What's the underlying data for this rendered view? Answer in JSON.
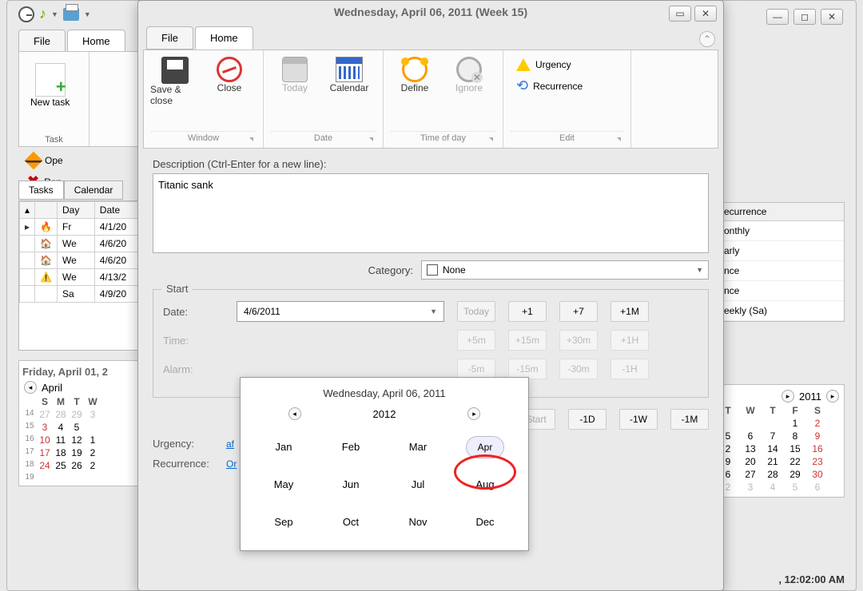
{
  "bg": {
    "file_tab": "File",
    "home_tab": "Home",
    "newtask": "New task",
    "open": "Ope",
    "rem": "Ren",
    "task_cap": "Task",
    "tabs": {
      "tasks": "Tasks",
      "calendar": "Calendar"
    },
    "grid": {
      "cols": [
        "",
        "",
        "Day",
        "Date"
      ],
      "rows": [
        {
          "icon": "fire",
          "day": "Fr",
          "date": "4/1/20"
        },
        {
          "icon": "house",
          "day": "We",
          "date": "4/6/20"
        },
        {
          "icon": "house",
          "day": "We",
          "date": "4/6/20"
        },
        {
          "icon": "warn",
          "day": "We",
          "date": "4/13/2"
        },
        {
          "icon": "",
          "day": "Sa",
          "date": "4/9/20"
        }
      ]
    },
    "cal_title": "Friday, April 01, 2",
    "cal_month": "April",
    "cal_dow": [
      "S",
      "M",
      "T",
      "W"
    ],
    "cal_weeks": [
      "14",
      "15",
      "16",
      "17",
      "18",
      "19"
    ],
    "cal_days": [
      [
        "27",
        "28",
        "29",
        "3"
      ],
      [
        "3",
        "4",
        "5",
        ""
      ],
      [
        "10",
        "11",
        "12",
        "1"
      ],
      [
        "17",
        "18",
        "19",
        "2"
      ],
      [
        "24",
        "25",
        "26",
        "2"
      ],
      [
        "",
        "",
        "",
        ""
      ]
    ]
  },
  "modal": {
    "title": "Wednesday, April 06, 2011 (Week 15)",
    "tabs": {
      "file": "File",
      "home": "Home"
    },
    "ribbon": {
      "save": "Save & close",
      "close": "Close",
      "window": "Window",
      "today": "Today",
      "calendar": "Calendar",
      "date": "Date",
      "define": "Define",
      "ignore": "Ignore",
      "tod": "Time of day",
      "urgency": "Urgency",
      "recurrence": "Recurrence",
      "edit": "Edit"
    },
    "desc_label": "Description (Ctrl-Enter for a new line):",
    "desc_value": "Titanic sank",
    "category_label": "Category:",
    "category_value": "None",
    "start": {
      "legend": "Start",
      "date_label": "Date:",
      "date_value": "4/6/2011",
      "today": "Today",
      "p1": "+1",
      "p7": "+7",
      "p1m": "+1M",
      "time_label": "Time:",
      "t_p5": "+5m",
      "t_p15": "+15m",
      "t_p30": "+30m",
      "t_p1h": "+1H",
      "alarm_label": "Alarm:",
      "a_m5": "-5m",
      "a_m15": "-15m",
      "a_m30": "-30m",
      "a_m1h": "-1H"
    },
    "lower": {
      "start_btn": "Start",
      "m1d": "-1D",
      "m1w": "-1W",
      "m1m": "-1M",
      "urgency_label": "Urgency:",
      "urgency_val": "af",
      "recur_label": "Recurrence:",
      "recur_val": "Or"
    }
  },
  "picker": {
    "title": "Wednesday, April 06, 2011",
    "year": "2012",
    "months": [
      "Jan",
      "Feb",
      "Mar",
      "Apr",
      "May",
      "Jun",
      "Jul",
      "Aug",
      "Sep",
      "Oct",
      "Nov",
      "Dec"
    ],
    "selected": 3
  },
  "right": {
    "recur_hdr": "ecurrence",
    "recur_items": [
      "onthly",
      "arly",
      "nce",
      "nce",
      "eekly (Sa)"
    ],
    "year": "2011",
    "cal_dow": [
      "T",
      "W",
      "T",
      "F",
      "S"
    ],
    "cal_rows": [
      [
        "",
        "",
        "",
        "1",
        "2"
      ],
      [
        "5",
        "6",
        "7",
        "8",
        "9"
      ],
      [
        "2",
        "13",
        "14",
        "15",
        "16"
      ],
      [
        "9",
        "20",
        "21",
        "22",
        "23"
      ],
      [
        "6",
        "27",
        "28",
        "29",
        "30"
      ],
      [
        "2",
        "3",
        "4",
        "5",
        "6"
      ]
    ],
    "status": ", 12:02:00 AM"
  }
}
